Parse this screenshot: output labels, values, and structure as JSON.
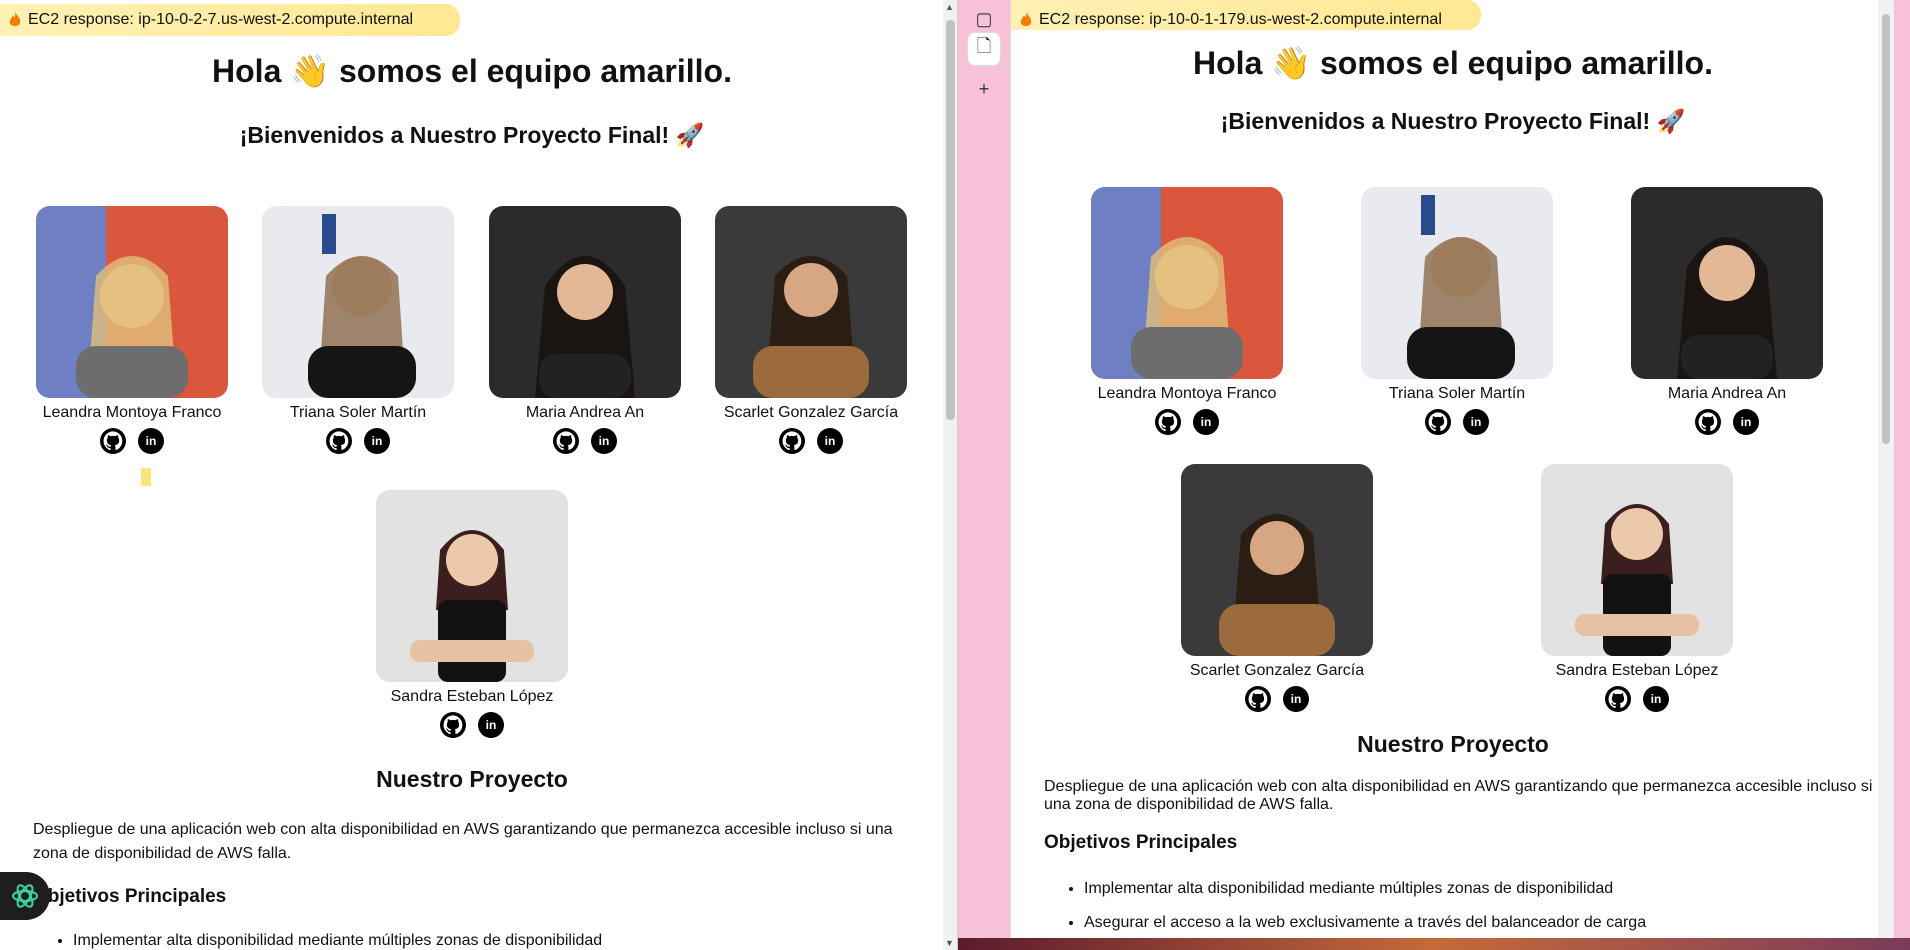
{
  "left": {
    "ec2_response": "EC2 response: ip-10-0-2-7.us-west-2.compute.internal",
    "hero": "Hola 👋 somos el equipo amarillo.",
    "subtitle": "¡Bienvenidos a Nuestro Proyecto Final! 🚀",
    "members": [
      {
        "name": "Leandra Montoya Franco"
      },
      {
        "name": "Triana Soler Martín"
      },
      {
        "name": "Maria Andrea An"
      },
      {
        "name": "Scarlet Gonzalez García"
      },
      {
        "name": "Sandra Esteban López"
      }
    ],
    "project_title": "Nuestro Proyecto",
    "project_desc": "Despliegue de una aplicación web con alta disponibilidad en AWS garantizando que permanezca accesible incluso si una zona de disponibilidad de AWS falla.",
    "objectives_title": "Objetivos Principales",
    "objectives": [
      "Implementar alta disponibilidad mediante múltiples zonas de disponibilidad"
    ]
  },
  "right": {
    "ec2_response": "EC2 response: ip-10-0-1-179.us-west-2.compute.internal",
    "hero": "Hola 👋 somos el equipo amarillo.",
    "subtitle": "¡Bienvenidos a Nuestro Proyecto Final! 🚀",
    "members": [
      {
        "name": "Leandra Montoya Franco"
      },
      {
        "name": "Triana Soler Martín"
      },
      {
        "name": "Maria Andrea An"
      },
      {
        "name": "Scarlet Gonzalez García"
      },
      {
        "name": "Sandra Esteban López"
      }
    ],
    "project_title": "Nuestro Proyecto",
    "project_desc": "Despliegue de una aplicación web con alta disponibilidad en AWS garantizando que permanezca accesible incluso si una zona de disponibilidad de AWS falla.",
    "objectives_title": "Objetivos Principales",
    "objectives": [
      "Implementar alta disponibilidad mediante múltiples zonas de disponibilidad",
      "Asegurar el acceso a la web exclusivamente a través del balanceador de carga"
    ]
  },
  "icons": {
    "github": "github-icon",
    "linkedin": "linkedin-icon",
    "linkedin_text": "in"
  },
  "colors": {
    "highlight": "#ffe37a",
    "sidebar": "#f7c2d8"
  }
}
